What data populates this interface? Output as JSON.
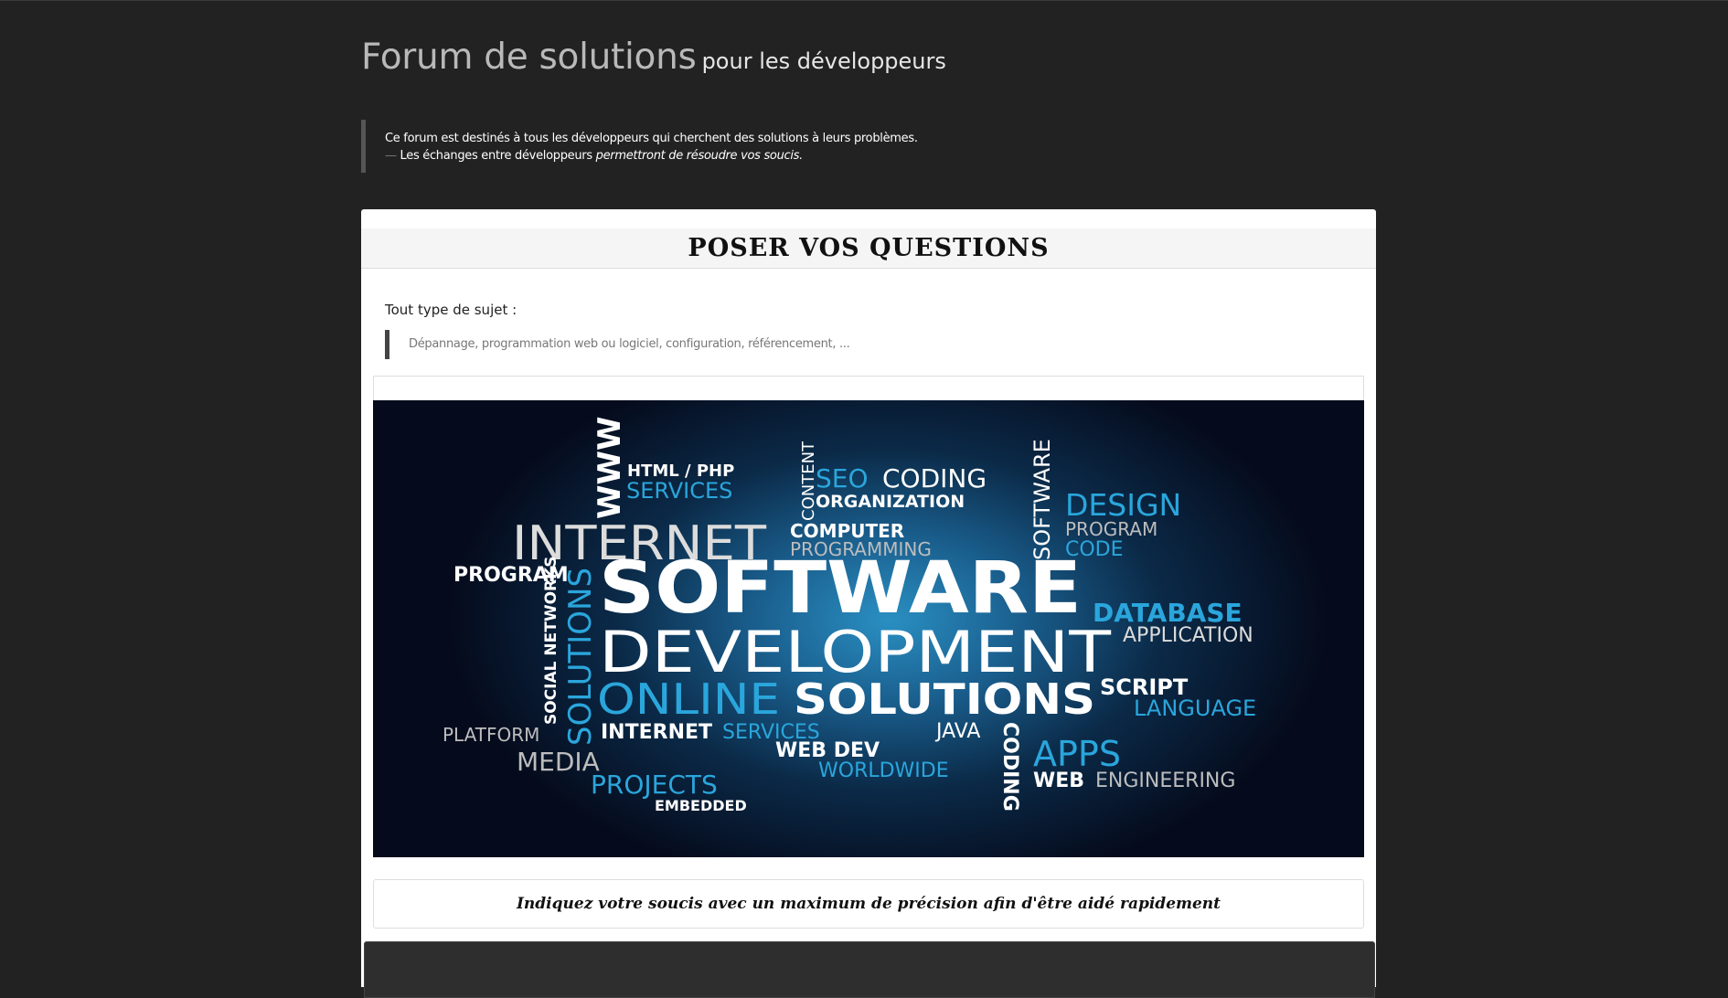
{
  "header": {
    "title": "Forum de solutions",
    "subtitle": "pour les développeurs"
  },
  "intro": {
    "line1": "Ce forum est destinés à tous les développeurs qui cherchent des solutions à leurs problèmes.",
    "line2_prefix": "Les échanges entre développeurs",
    "line2_italic": "permettront de résoudre vos soucis."
  },
  "panel": {
    "heading": "POSER VOS QUESTIONS",
    "subject_label": "Tout type de sujet :",
    "subject_examples": "Dépannage, programmation web ou logiciel, configuration, référencement, ...",
    "instruction": "Indiquez votre soucis avec un maximum de précision afin d'être aidé rapidement"
  },
  "banner_words": {
    "www": "WWW",
    "html_php": "HTML / PHP",
    "services1": "SERVICES",
    "content": "CONTENT",
    "seo": "SEO",
    "coding1": "CODING",
    "organization": "ORGANIZATION",
    "software_v": "SOFTWARE",
    "design": "DESIGN",
    "program1": "PROGRAM",
    "code": "CODE",
    "internet1": "INTERNET",
    "computer": "COMPUTER",
    "programming": "PROGRAMMING",
    "program2": "PROGRAM",
    "software": "SOFTWARE",
    "social_networks": "SOCIAL NETWORKS",
    "solutions_v": "SOLUTIONS",
    "development": "DEVELOPMENT",
    "database": "DATABASE",
    "application": "APPLICATION",
    "online": "ONLINE",
    "solutions": "SOLUTIONS",
    "script": "SCRIPT",
    "language": "LANGUAGE",
    "platform": "PLATFORM",
    "internet2": "INTERNET",
    "services2": "SERVICES",
    "java": "JAVA",
    "coding2": "CODING",
    "apps": "APPS",
    "media": "MEDIA",
    "web_dev": "WEB DEV",
    "worldwide": "WORLDWIDE",
    "web": "WEB",
    "engineering": "ENGINEERING",
    "projects": "PROJECTS",
    "embedded": "EMBEDDED"
  },
  "colors": {
    "page_bg": "#222222",
    "banner_blue": "#2aa6dc"
  }
}
